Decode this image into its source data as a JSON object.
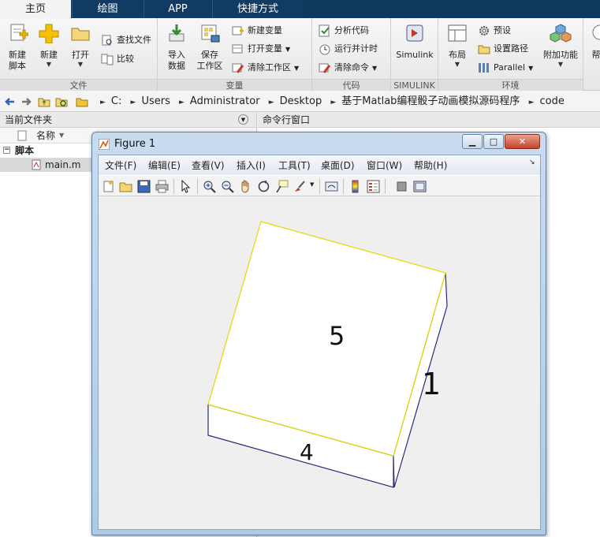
{
  "ribbon_tabs": [
    "主页",
    "绘图",
    "APP",
    "快捷方式"
  ],
  "file_group": {
    "label": "文件",
    "new_script": "新建\n脚本",
    "new": "新建",
    "open": "打开",
    "find_files": "查找文件",
    "compare": "比较"
  },
  "variable_group": {
    "label": "变量",
    "import": "导入\n数据",
    "save_ws": "保存\n工作区",
    "new_var": "新建变量",
    "open_var": "打开变量",
    "clear_ws": "清除工作区"
  },
  "code_group": {
    "label": "代码",
    "analyze": "分析代码",
    "run_time": "运行并计时",
    "clear_cmd": "清除命令"
  },
  "simulink_group": {
    "label": "SIMULINK",
    "simulink": "Simulink"
  },
  "env_group": {
    "label": "环境",
    "layout": "布局",
    "prefs": "预设",
    "set_path": "设置路径",
    "parallel": "Parallel",
    "addons": "附加功能",
    "help": "帮"
  },
  "address": {
    "crumbs": [
      "C:",
      "Users",
      "Administrator",
      "Desktop",
      "基于Matlab编程骰子动画模拟源码程序",
      "code"
    ]
  },
  "current_folder": {
    "title": "当前文件夹",
    "column_name": "名称",
    "group_label": "脚本",
    "files": [
      "main.m"
    ]
  },
  "command_window": {
    "title": "命令行窗口"
  },
  "figure": {
    "title": "Figure 1",
    "menus": [
      "文件(F)",
      "编辑(E)",
      "查看(V)",
      "插入(I)",
      "工具(T)",
      "桌面(D)",
      "窗口(W)",
      "帮助(H)"
    ],
    "face_labels": {
      "top": "5",
      "right": "1",
      "front": "4"
    },
    "colors": {
      "top_edge": "#e6d800",
      "side_edge": "#2a2a7a"
    }
  },
  "colors": {
    "tabbar": "#0f3a5e",
    "ribbon": "#efefef",
    "accent": "#1a6fc9"
  }
}
